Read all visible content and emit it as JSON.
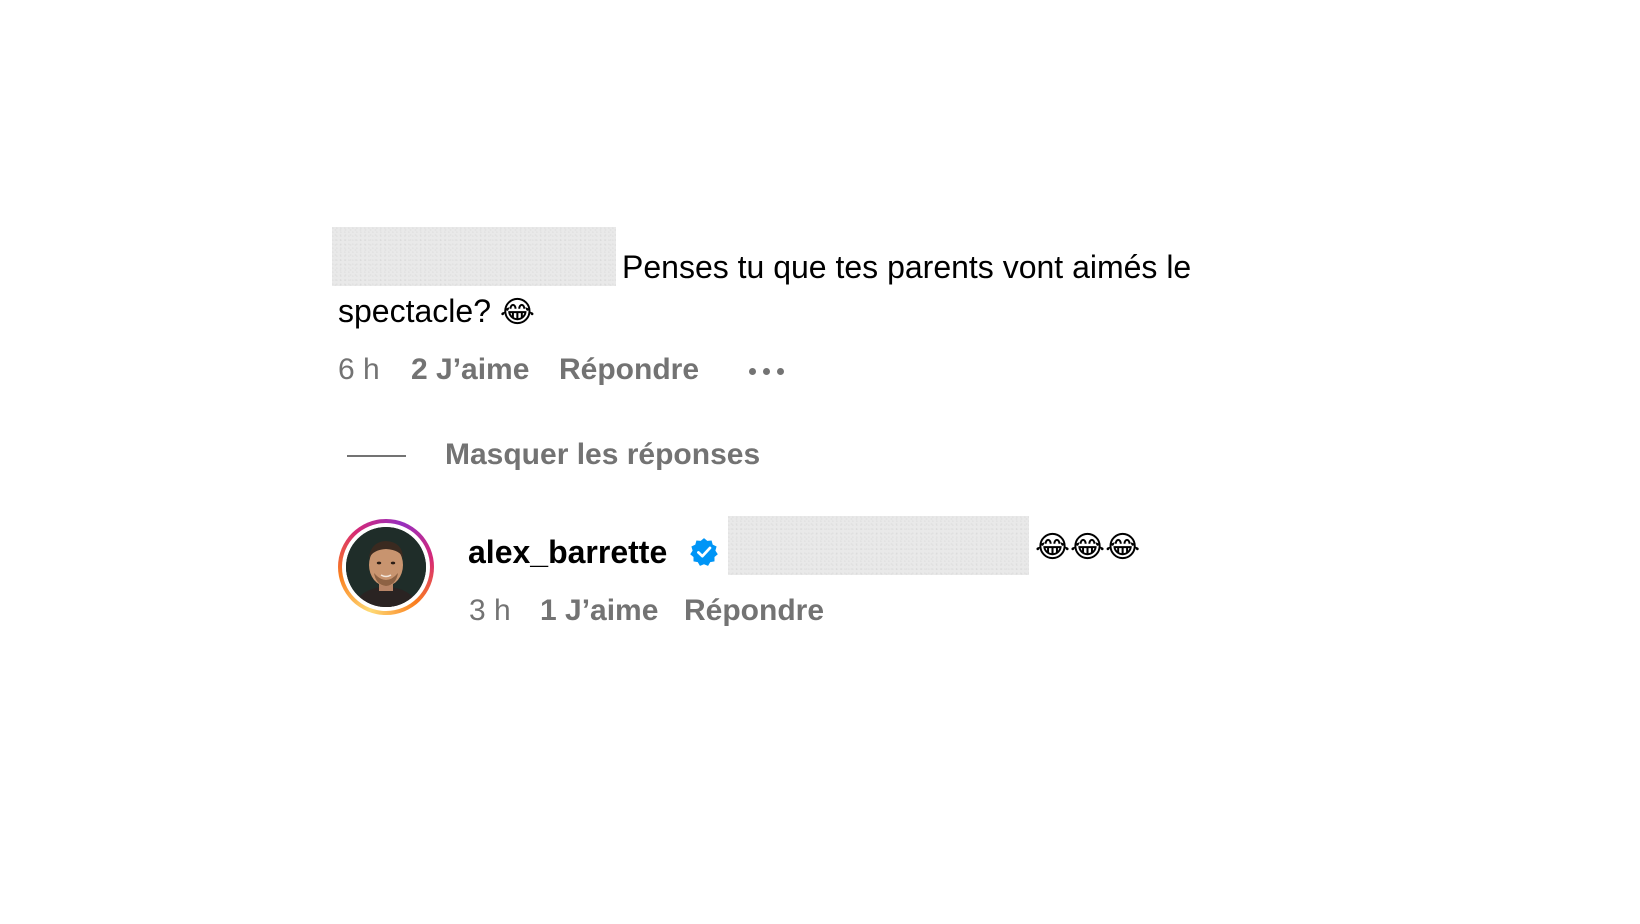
{
  "comment": {
    "text_line1": "Penses tu que tes parents vont aimés le",
    "text_line2": "spectacle?",
    "emoji": "😂",
    "time": "6 h",
    "likes": "2 J’aime",
    "reply_label": "Répondre",
    "more_icon": "ellipsis-icon"
  },
  "replies_toggle": {
    "label": "Masquer les réponses"
  },
  "reply": {
    "username": "alex_barrette",
    "verified_icon": "verified-badge-icon",
    "emoji": "😂😂😂",
    "time": "3 h",
    "likes": "1 J’aime",
    "reply_label": "Répondre"
  },
  "colors": {
    "meta_text": "#737373",
    "verified_blue": "#0095f6",
    "redaction_gray": "#e9e9e9"
  }
}
